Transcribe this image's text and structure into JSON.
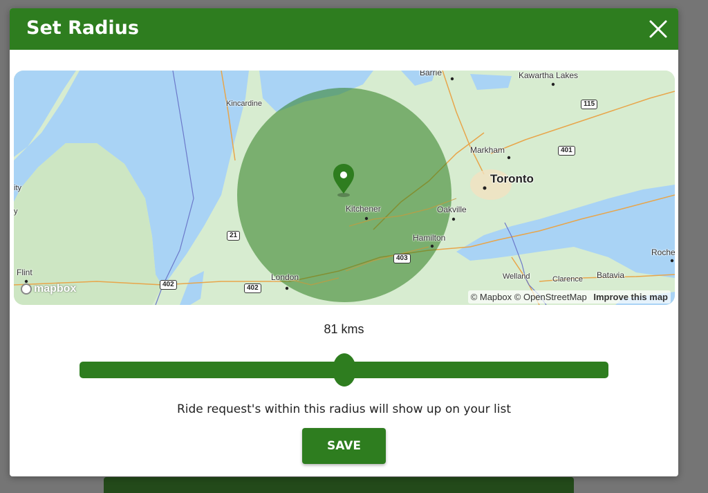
{
  "modal": {
    "title": "Set Radius",
    "close_icon": "close-icon"
  },
  "map": {
    "labels": {
      "barrie": "Barrie",
      "kawartha": "Kawartha Lakes",
      "kincardine": "Kincardine",
      "markham": "Markham",
      "toronto": "Toronto",
      "kitchener": "Kitchener",
      "oakville": "Oakville",
      "hamilton": "Hamilton",
      "london": "London",
      "welland": "Welland",
      "clarence": "Clarence",
      "batavia": "Batavia",
      "flint": "Flint",
      "rochester_partial": "Roche",
      "city_partial": "ity",
      "y_partial": "y"
    },
    "shields": {
      "hwy115": "115",
      "hwy401": "401",
      "hwy21": "21",
      "hwy402a": "402",
      "hwy402b": "402",
      "hwy403": "403"
    },
    "logo_text": "mapbox",
    "attribution": {
      "mapbox": "© Mapbox",
      "osm": "© OpenStreetMap",
      "improve": "Improve this map"
    },
    "marker_icon": "map-pin-icon",
    "radius_color": "#2e7d1f"
  },
  "radius": {
    "value_label": "81 kms",
    "slider_fraction": 0.5
  },
  "help_text": "Ride request's within this radius will show up on your list",
  "save_label": "SAVE",
  "colors": {
    "primary": "#2e7d1f",
    "water": "#a9d3f5",
    "land": "#d7ecd0"
  }
}
